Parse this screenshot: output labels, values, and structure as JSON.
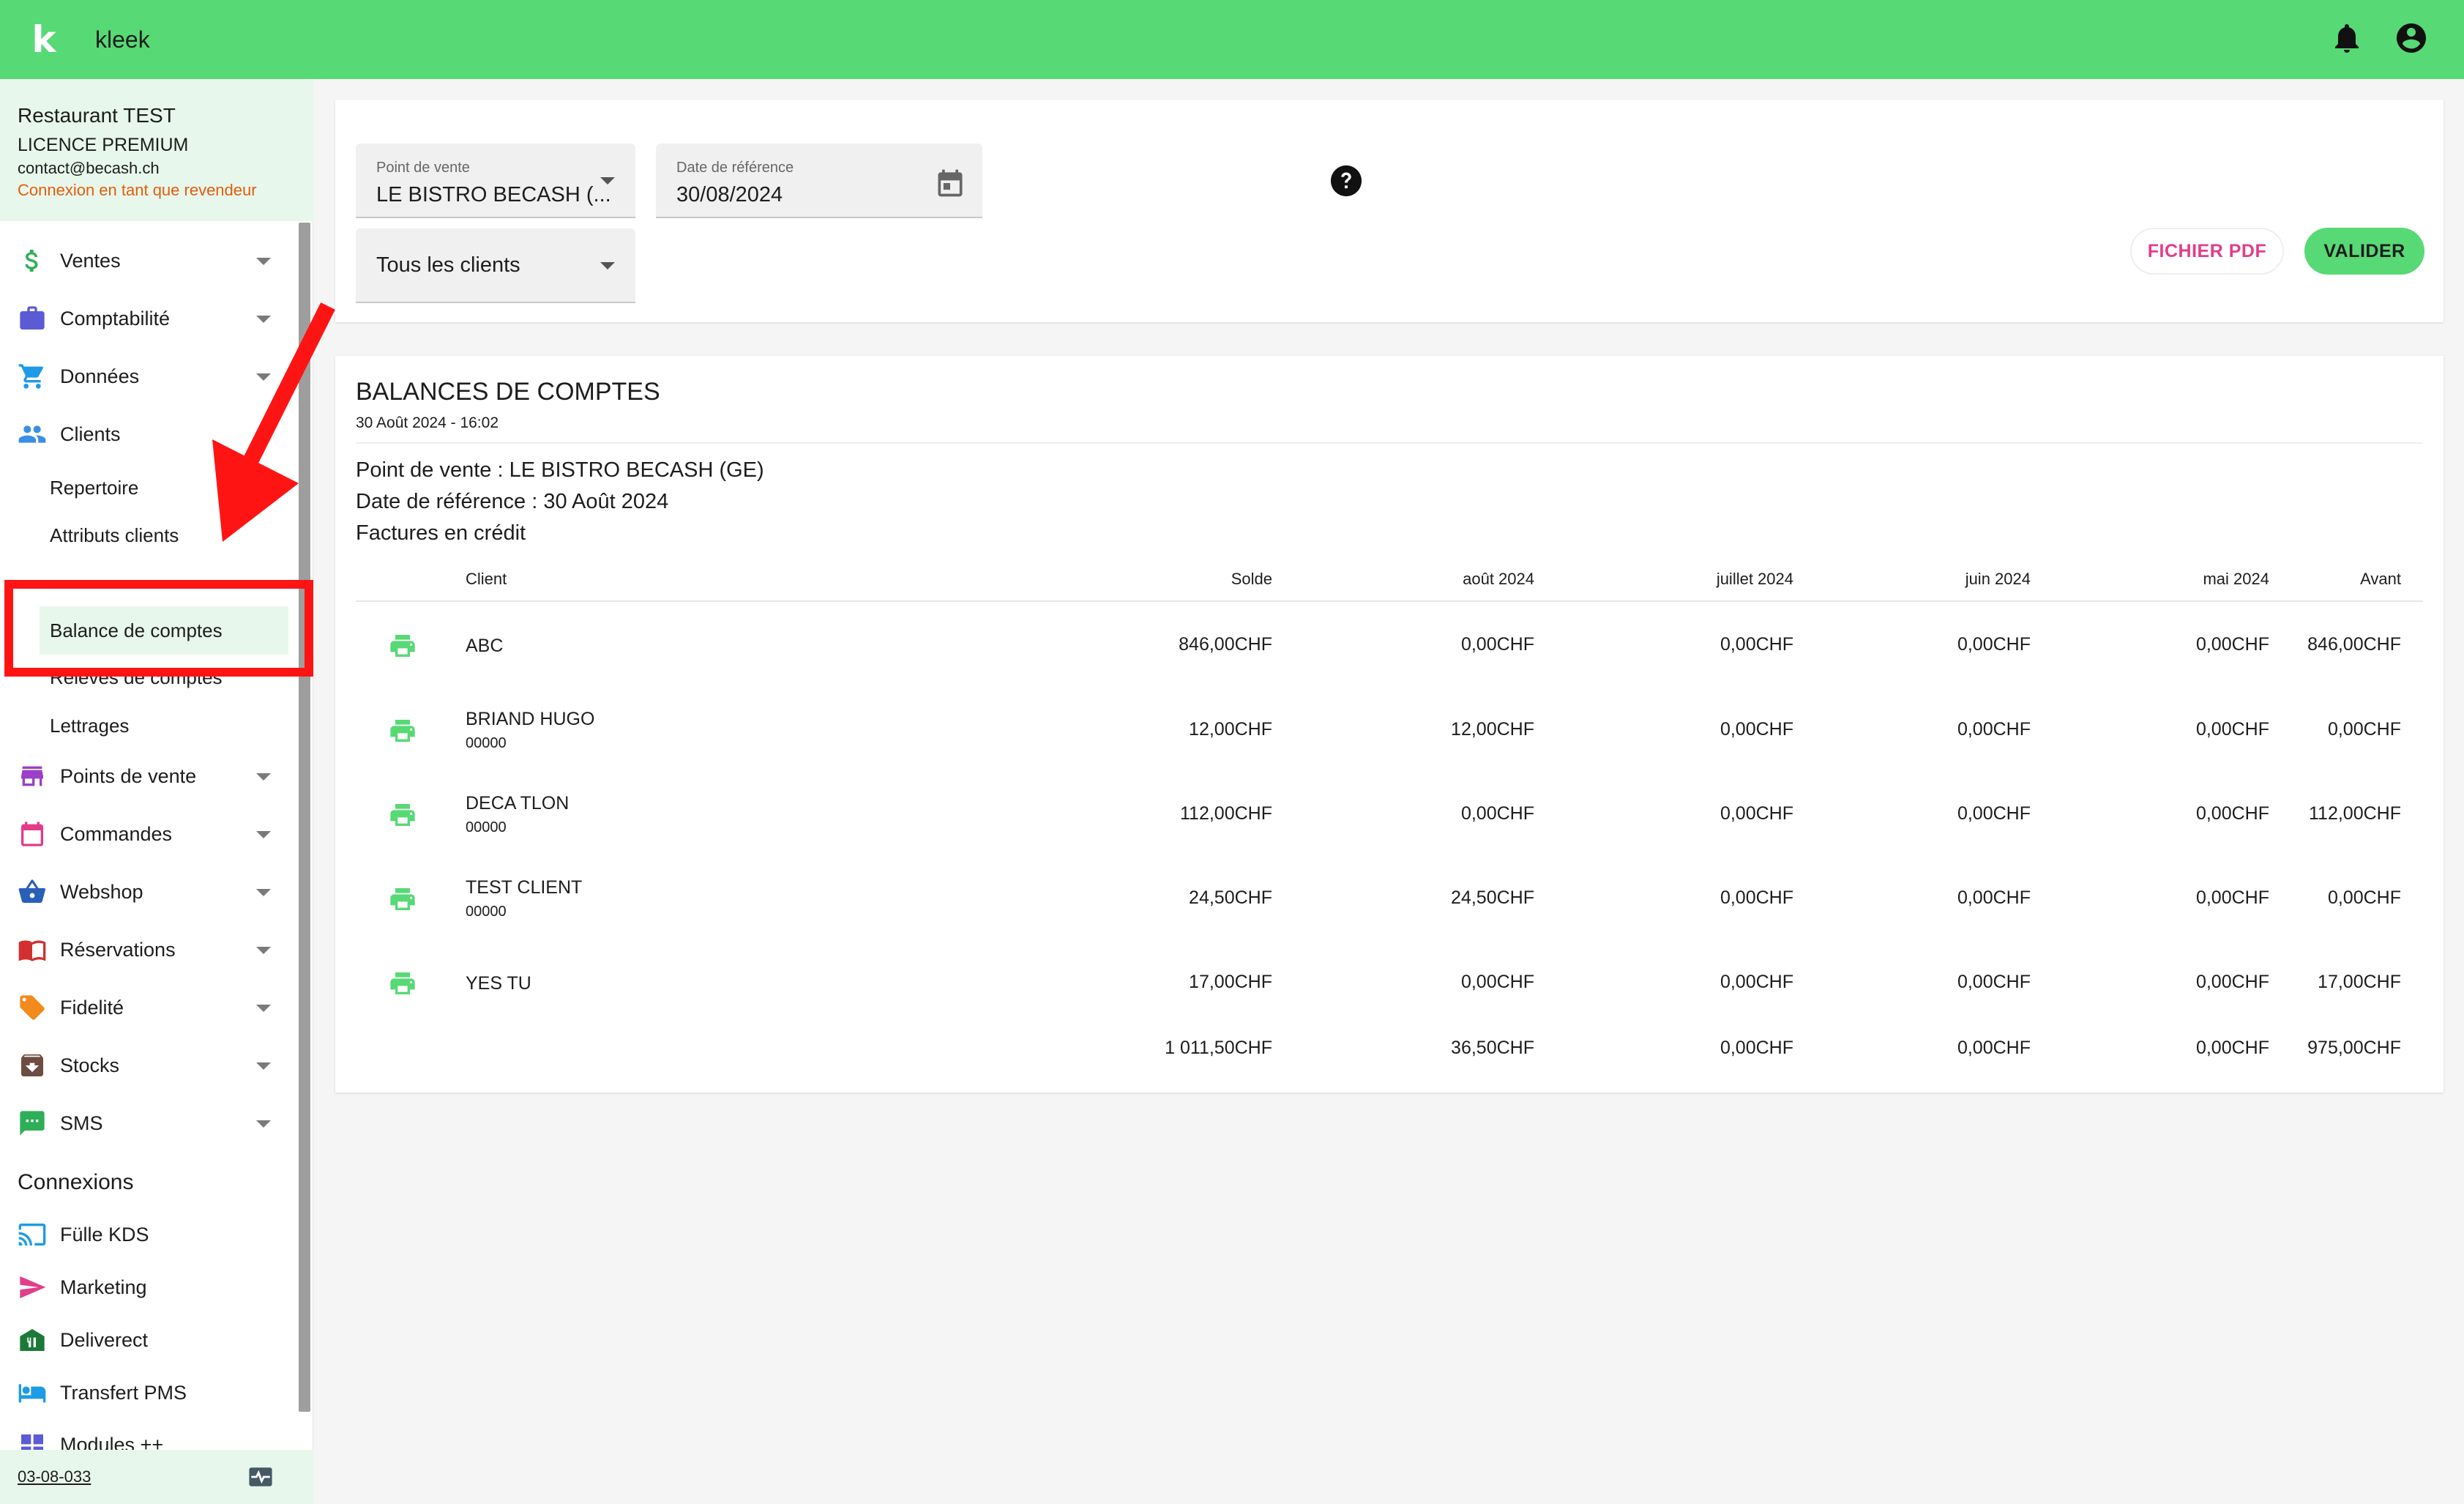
{
  "app": {
    "name": "kleek",
    "logo_letter": "k",
    "accent": "#57d975",
    "accent_light": "#e8f7ec"
  },
  "account": {
    "name": "Restaurant TEST",
    "license": "LICENCE PREMIUM",
    "email": "contact@becash.ch",
    "reseller_link": "Connexion en tant que revendeur"
  },
  "nav": {
    "ventes": "Ventes",
    "comptabilite": "Comptabilité",
    "donnees": "Données",
    "clients": "Clients",
    "clients_sub": {
      "repertoire": "Repertoire",
      "attributs": "Attributs clients",
      "balance": "Balance de comptes",
      "releves": "Relevés de comptes",
      "lettrages": "Lettrages"
    },
    "points_de_vente": "Points de vente",
    "commandes": "Commandes",
    "webshop": "Webshop",
    "reservations": "Réservations",
    "fidelite": "Fidelité",
    "stocks": "Stocks",
    "sms": "SMS"
  },
  "connexions": {
    "title": "Connexions",
    "fulle_kds": "Fülle KDS",
    "marketing": "Marketing",
    "deliverect": "Deliverect",
    "transfert_pms": "Transfert PMS",
    "modules": "Modules ++"
  },
  "footer": {
    "version": "03-08-033"
  },
  "filters": {
    "pos_label": "Point de vente",
    "pos_value": "LE BISTRO BECASH (...",
    "date_label": "Date de référence",
    "date_value": "30/08/2024",
    "clients_value": "Tous les clients",
    "pdf_button": "FICHIER PDF",
    "validate_button": "VALIDER"
  },
  "report": {
    "title": "BALANCES DE COMPTES",
    "generated": "30 Août 2024 - 16:02",
    "pos_line": "Point de vente : LE BISTRO BECASH (GE)",
    "date_line": "Date de référence : 30 Août 2024",
    "type_line": "Factures en crédit",
    "columns": {
      "client": "Client",
      "solde": "Solde",
      "aout": "août 2024",
      "juillet": "juillet 2024",
      "juin": "juin 2024",
      "mai": "mai 2024",
      "avant": "Avant"
    },
    "rows": [
      {
        "client": "ABC",
        "code": "",
        "solde": "846,00CHF",
        "aout": "0,00CHF",
        "juillet": "0,00CHF",
        "juin": "0,00CHF",
        "mai": "0,00CHF",
        "avant": "846,00CHF"
      },
      {
        "client": "BRIAND HUGO",
        "code": "00000",
        "solde": "12,00CHF",
        "aout": "12,00CHF",
        "juillet": "0,00CHF",
        "juin": "0,00CHF",
        "mai": "0,00CHF",
        "avant": "0,00CHF"
      },
      {
        "client": "DECA TLON",
        "code": "00000",
        "solde": "112,00CHF",
        "aout": "0,00CHF",
        "juillet": "0,00CHF",
        "juin": "0,00CHF",
        "mai": "0,00CHF",
        "avant": "112,00CHF"
      },
      {
        "client": "TEST CLIENT",
        "code": "00000",
        "solde": "24,50CHF",
        "aout": "24,50CHF",
        "juillet": "0,00CHF",
        "juin": "0,00CHF",
        "mai": "0,00CHF",
        "avant": "0,00CHF"
      },
      {
        "client": "YES TU",
        "code": "",
        "solde": "17,00CHF",
        "aout": "0,00CHF",
        "juillet": "0,00CHF",
        "juin": "0,00CHF",
        "mai": "0,00CHF",
        "avant": "17,00CHF"
      }
    ],
    "totals": {
      "solde": "1 011,50CHF",
      "aout": "36,50CHF",
      "juillet": "0,00CHF",
      "juin": "0,00CHF",
      "mai": "0,00CHF",
      "avant": "975,00CHF"
    }
  }
}
